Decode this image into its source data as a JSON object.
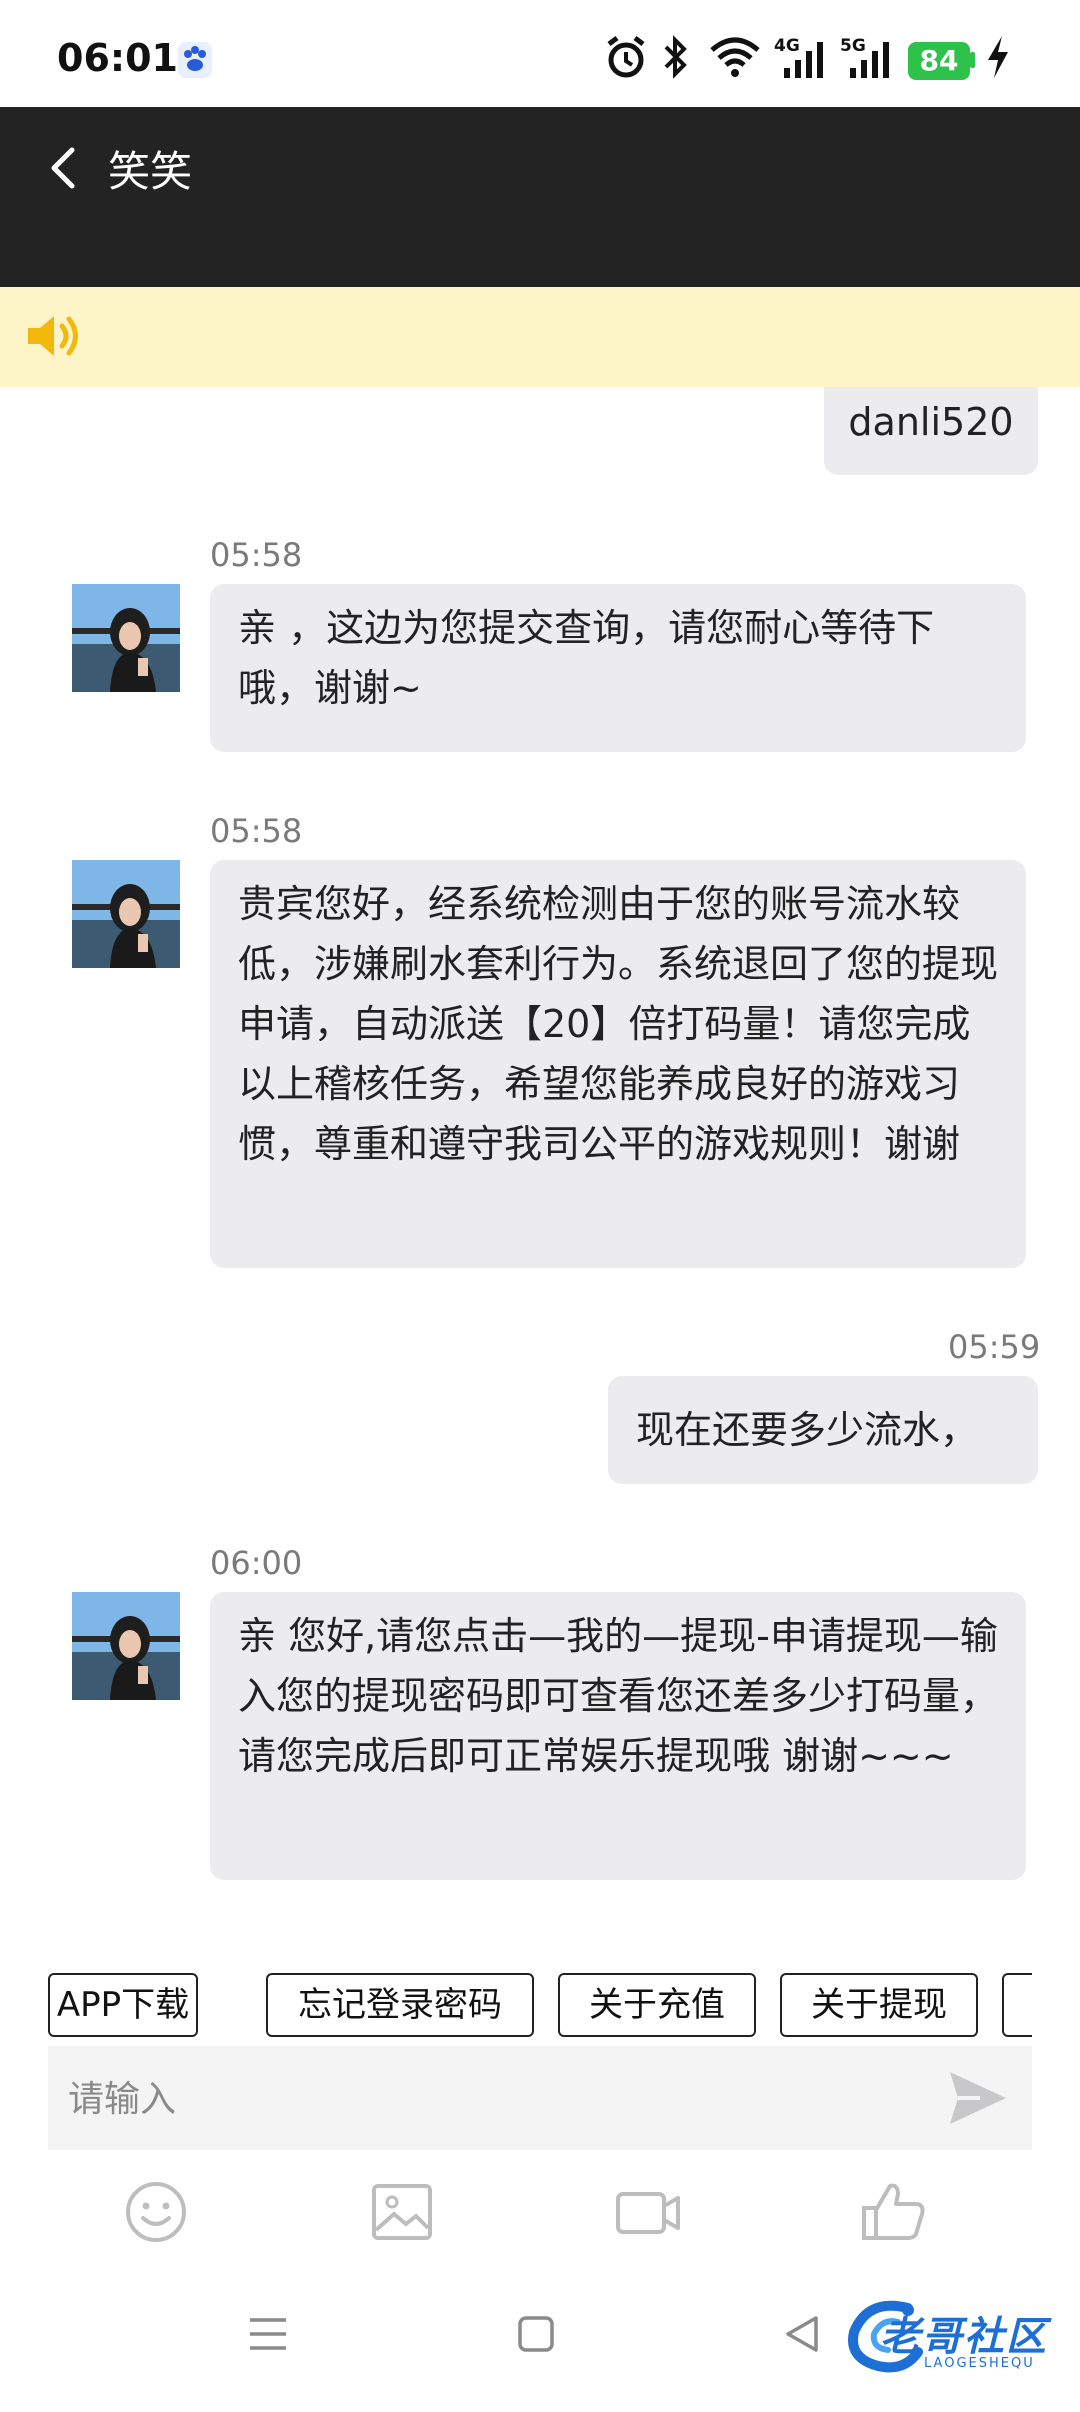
{
  "status_bar": {
    "time": "06:01",
    "network_4g": "4G",
    "network_5g": "5G",
    "battery": "84"
  },
  "header": {
    "title": "笑笑"
  },
  "messages": [
    {
      "side": "right",
      "text": "danli520"
    },
    {
      "side": "left",
      "time": "05:58",
      "text": "亲 ，这边为您提交查询，请您耐心等待下哦，谢谢~"
    },
    {
      "side": "left",
      "time": "05:58",
      "text": "贵宾您好，经系统检测由于您的账号流水较低，涉嫌刷水套利行为。系统退回了您的提现申请，自动派送【20】倍打码量！请您完成以上稽核任务，希望您能养成良好的游戏习惯，尊重和遵守我司公平的游戏规则！谢谢"
    },
    {
      "side": "right",
      "time": "05:59",
      "text": "现在还要多少流水，"
    },
    {
      "side": "left",
      "time": "06:00",
      "text": "亲 您好,请您点击—我的—提现-申请提现—输入您的提现密码即可查看您还差多少打码量，请您完成后即可正常娱乐提现哦 谢谢~~~"
    }
  ],
  "quick_replies": [
    "APP下载",
    "忘记登录密码",
    "关于充值",
    "关于提现"
  ],
  "input": {
    "placeholder": "请输入"
  },
  "watermark": {
    "text": "老哥社区",
    "sub": "LAOGESHEQU"
  }
}
